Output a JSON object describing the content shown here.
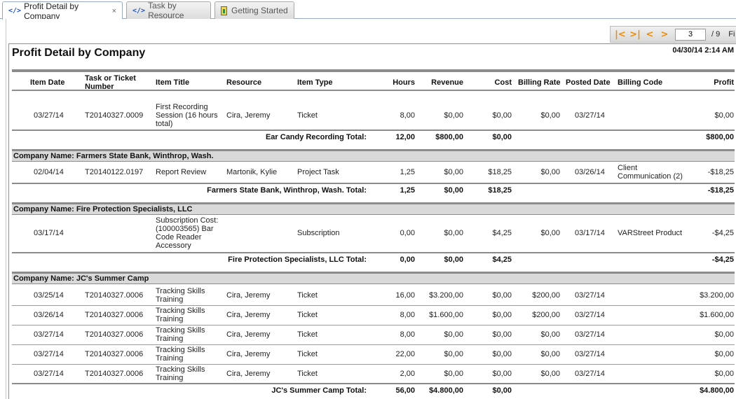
{
  "tabs": [
    {
      "label": "Profit Detail by Company",
      "icon": "code-icon",
      "active": true,
      "close": "×"
    },
    {
      "label": "Task by Resource",
      "icon": "code-icon",
      "active": false
    },
    {
      "label": "Getting Started",
      "icon": "book-icon",
      "active": false
    }
  ],
  "pager": {
    "page": "3",
    "of": "/ 9",
    "find": "Fi"
  },
  "report": {
    "title": "Profit Detail by Company",
    "date": "04/30/14 2:14 AM",
    "columns": {
      "item_date": "Item Date",
      "task_number": "Task or Ticket Number",
      "item_title": "Item Title",
      "resource": "Resource",
      "item_type": "Item Type",
      "hours": "Hours",
      "revenue": "Revenue",
      "cost": "Cost",
      "billing_rate": "Billing Rate",
      "posted_date": "Posted Date",
      "billing_code": "Billing Code",
      "profit": "Profit"
    },
    "groups": [
      {
        "name": "",
        "rows": [
          {
            "date": "03/27/14",
            "number": "T20140327.0009",
            "title": "First Recording Session (16 hours total)",
            "resource": "Cira, Jeremy",
            "type": "Ticket",
            "hours": "8,00",
            "revenue": "$0,00",
            "cost": "$0,00",
            "rate": "$0,00",
            "posted": "03/27/14",
            "code": "",
            "profit": "$0,00"
          }
        ],
        "total": {
          "label": "Ear Candy Recording Total:",
          "hours": "12,00",
          "revenue": "$800,00",
          "cost": "$0,00",
          "profit": "$800,00"
        }
      },
      {
        "name": "Company Name: Farmers State Bank, Winthrop, Wash.",
        "rows": [
          {
            "date": "02/04/14",
            "number": "T20140122.0197",
            "title": "Report Review",
            "resource": "Martonik, Kylie",
            "type": "Project Task",
            "hours": "1,25",
            "revenue": "$0,00",
            "cost": "$18,25",
            "rate": "$0,00",
            "posted": "03/26/14",
            "code": "Client Communication (2)",
            "profit": "-$18,25"
          }
        ],
        "total": {
          "label": "Farmers State Bank, Winthrop, Wash. Total:",
          "hours": "1,25",
          "revenue": "$0,00",
          "cost": "$18,25",
          "profit": "-$18,25"
        }
      },
      {
        "name": "Company Name: Fire Protection Specialists, LLC",
        "rows": [
          {
            "date": "03/17/14",
            "number": "",
            "title": "Subscription Cost: (100003565) Bar Code Reader Accessory",
            "resource": "",
            "type": "Subscription",
            "hours": "0,00",
            "revenue": "$0,00",
            "cost": "$4,25",
            "rate": "$0,00",
            "posted": "03/17/14",
            "code": "VARStreet Product",
            "profit": "-$4,25"
          }
        ],
        "total": {
          "label": "Fire Protection Specialists, LLC Total:",
          "hours": "0,00",
          "revenue": "$0,00",
          "cost": "$4,25",
          "profit": "-$4,25"
        }
      },
      {
        "name": "Company Name: JC's Summer Camp",
        "rows": [
          {
            "date": "03/25/14",
            "number": "T20140327.0006",
            "title": "Tracking Skills Training",
            "resource": "Cira, Jeremy",
            "type": "Ticket",
            "hours": "16,00",
            "revenue": "$3.200,00",
            "cost": "$0,00",
            "rate": "$200,00",
            "posted": "03/27/14",
            "code": "",
            "profit": "$3.200,00"
          },
          {
            "date": "03/26/14",
            "number": "T20140327.0006",
            "title": "Tracking Skills Training",
            "resource": "Cira, Jeremy",
            "type": "Ticket",
            "hours": "8,00",
            "revenue": "$1.600,00",
            "cost": "$0,00",
            "rate": "$200,00",
            "posted": "03/27/14",
            "code": "",
            "profit": "$1.600,00"
          },
          {
            "date": "03/27/14",
            "number": "T20140327.0006",
            "title": "Tracking Skills Training",
            "resource": "Cira, Jeremy",
            "type": "Ticket",
            "hours": "8,00",
            "revenue": "$0,00",
            "cost": "$0,00",
            "rate": "$0,00",
            "posted": "03/27/14",
            "code": "",
            "profit": "$0,00"
          },
          {
            "date": "03/27/14",
            "number": "T20140327.0006",
            "title": "Tracking Skills Training",
            "resource": "Cira, Jeremy",
            "type": "Ticket",
            "hours": "22,00",
            "revenue": "$0,00",
            "cost": "$0,00",
            "rate": "$0,00",
            "posted": "03/27/14",
            "code": "",
            "profit": "$0,00"
          },
          {
            "date": "03/27/14",
            "number": "T20140327.0006",
            "title": "Tracking Skills Training",
            "resource": "Cira, Jeremy",
            "type": "Ticket",
            "hours": "2,00",
            "revenue": "$0,00",
            "cost": "$0,00",
            "rate": "$0,00",
            "posted": "03/27/14",
            "code": "",
            "profit": "$0,00"
          }
        ],
        "total": {
          "label": "JC's Summer Camp Total:",
          "hours": "56,00",
          "revenue": "$4.800,00",
          "cost": "$0,00",
          "profit": "$4.800,00"
        }
      }
    ]
  }
}
